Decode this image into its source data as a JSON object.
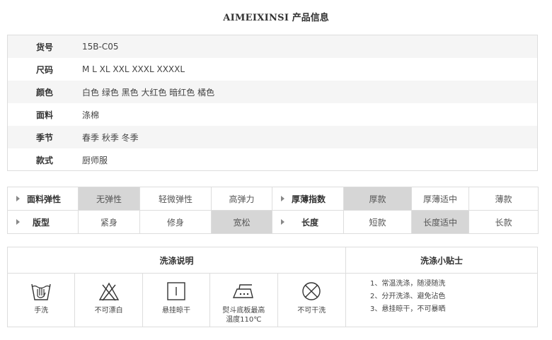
{
  "title": {
    "brand": "AIMEIXINSI",
    "suffix": " 产品信息"
  },
  "info": [
    {
      "label": "货号",
      "value": "15B-C05"
    },
    {
      "label": "尺码",
      "value": "M L XL XXL XXXL XXXXL"
    },
    {
      "label": "颜色",
      "value": "白色 绿色 黑色 大红色 暗红色 橘色"
    },
    {
      "label": "面料",
      "value": "涤棉"
    },
    {
      "label": "季节",
      "value": "春季  秋季  冬季"
    },
    {
      "label": "款式",
      "value": "厨师服"
    }
  ],
  "attributes": {
    "row1": {
      "left_head": "面料弹性",
      "left_options": [
        "无弹性",
        "轻微弹性",
        "高弹力"
      ],
      "left_selected": 0,
      "right_head": "厚薄指数",
      "right_options": [
        "厚款",
        "厚薄适中",
        "薄款"
      ],
      "right_selected": 0
    },
    "row2": {
      "left_head": "版型",
      "left_options": [
        "紧身",
        "修身",
        "宽松"
      ],
      "left_selected": 2,
      "right_head": "长度",
      "right_options": [
        "短款",
        "长度适中",
        "长款"
      ],
      "right_selected": 1
    }
  },
  "care": {
    "wash_header": "洗涤说明",
    "tips_header": "洗涤小贴士",
    "icons": [
      {
        "icon": "hand-wash-icon",
        "label": "手洗"
      },
      {
        "icon": "no-bleach-icon",
        "label": "不可漂白"
      },
      {
        "icon": "hang-dry-icon",
        "label": "悬挂晾干"
      },
      {
        "icon": "iron-icon",
        "label": "熨斗底板最高\n温度110℃"
      },
      {
        "icon": "no-dry-clean-icon",
        "label": "不可干洗"
      }
    ],
    "tips": [
      "1、常温洗涤，随浸随洗",
      "2、分开洗涤、避免沾色",
      "3、悬挂晾干，不可暴晒"
    ]
  }
}
